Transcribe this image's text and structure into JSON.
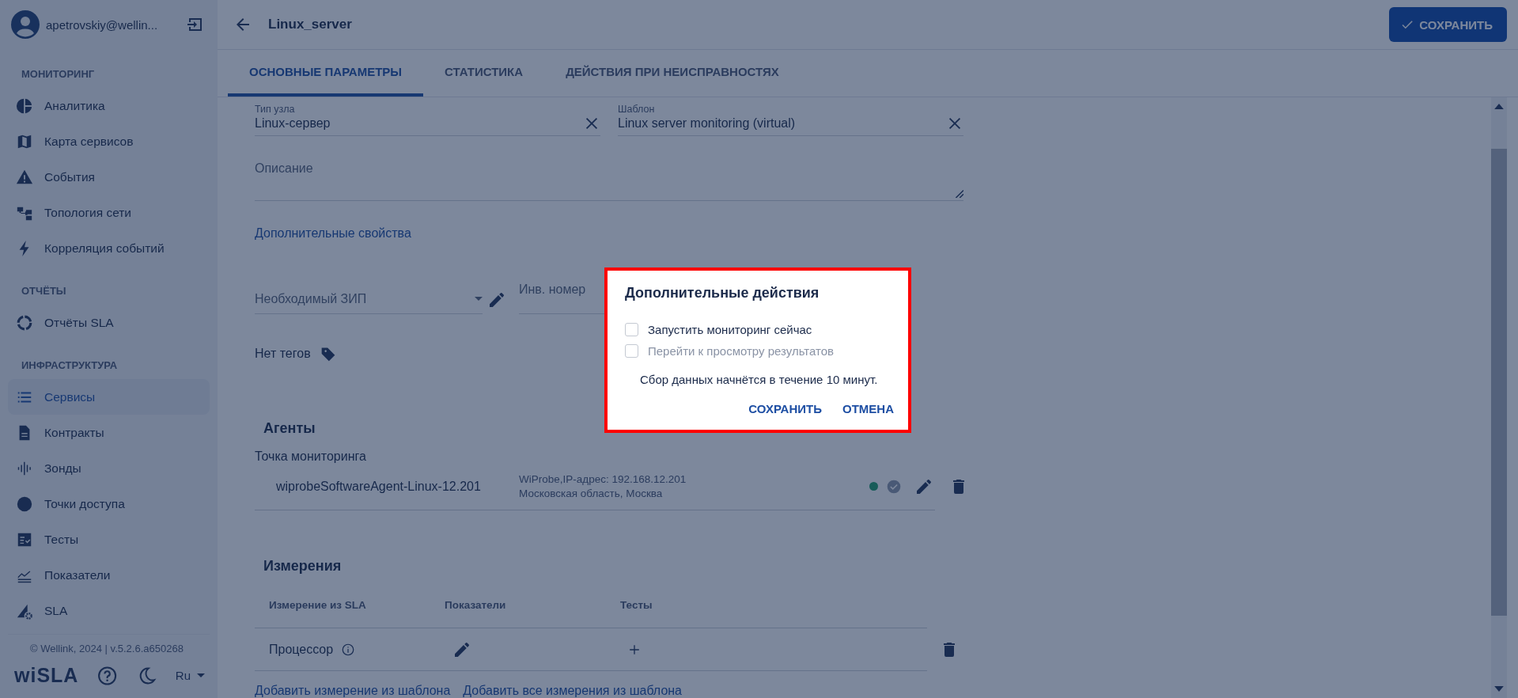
{
  "user": {
    "name": "apetrovskiy@wellin..."
  },
  "sidebar": {
    "sections": [
      {
        "title": "МОНИТОРИНГ",
        "items": [
          {
            "label": "Аналитика",
            "selected": false
          },
          {
            "label": "Карта сервисов",
            "selected": false
          },
          {
            "label": "События",
            "selected": false
          },
          {
            "label": "Топология сети",
            "selected": false
          },
          {
            "label": "Корреляция событий",
            "selected": false
          }
        ]
      },
      {
        "title": "ОТЧЁТЫ",
        "items": [
          {
            "label": "Отчёты SLA",
            "selected": false
          }
        ]
      },
      {
        "title": "ИНФРАСТРУКТУРА",
        "items": [
          {
            "label": "Сервисы",
            "selected": true
          },
          {
            "label": "Контракты",
            "selected": false
          },
          {
            "label": "Зонды",
            "selected": false
          },
          {
            "label": "Точки доступа",
            "selected": false
          },
          {
            "label": "Тесты",
            "selected": false
          },
          {
            "label": "Показатели",
            "selected": false
          },
          {
            "label": "SLA",
            "selected": false
          }
        ]
      }
    ],
    "footer": "© Wellink, 2024 | v.5.2.6.a650268",
    "logo": "wiSLA",
    "language": "Ru"
  },
  "header": {
    "title": "Linux_server",
    "save_button": "СОХРАНИТЬ"
  },
  "tabs": [
    {
      "label": "ОСНОВНЫЕ ПАРАМЕТРЫ",
      "selected": true
    },
    {
      "label": "СТАТИСТИКА",
      "selected": false
    },
    {
      "label": "ДЕЙСТВИЯ ПРИ НЕИСПРАВНОСТЯХ",
      "selected": false
    }
  ],
  "form": {
    "node_type": {
      "label": "Тип узла",
      "value": "Linux-сервер"
    },
    "template": {
      "label": "Шаблон",
      "value": "Linux server monitoring (virtual)"
    },
    "description": {
      "placeholder": "Описание"
    },
    "extra_link": "Дополнительные свойства",
    "spare": {
      "placeholder": "Необходимый ЗИП"
    },
    "inventory": {
      "placeholder": "Инв. номер"
    },
    "tags": "Нет тегов"
  },
  "agents": {
    "title": "Агенты",
    "subtitle": "Точка мониторинга",
    "rows": [
      {
        "name": "wiprobeSoftwareAgent-Linux-12.201",
        "info": "WiProbe,IP-адрес: 192.168.12.201",
        "location": "Московская область, Москва",
        "online": true
      }
    ]
  },
  "measurements": {
    "title": "Измерения",
    "columns": [
      "Измерение из SLA",
      "Показатели",
      "Тесты"
    ],
    "rows": [
      {
        "name": "Процессор"
      }
    ],
    "links": [
      "Добавить измерение из шаблона",
      "Добавить все измерения из шаблона"
    ]
  },
  "dialog": {
    "title": "Дополнительные действия",
    "options": [
      {
        "label": "Запустить мониторинг сейчас",
        "checked": false,
        "disabled": false
      },
      {
        "label": "Перейти к просмотру результатов",
        "checked": false,
        "disabled": true
      }
    ],
    "note": "Сбор данных начнётся в течение 10 минут.",
    "buttons": [
      "СОХРАНИТЬ",
      "ОТМЕНА"
    ]
  }
}
